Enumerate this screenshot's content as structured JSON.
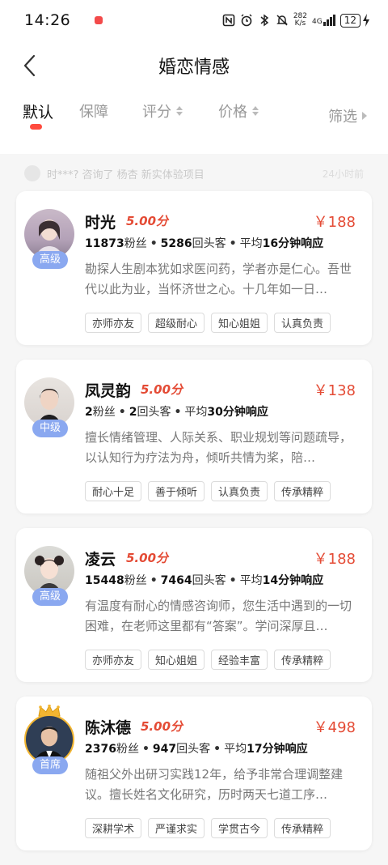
{
  "status_bar": {
    "time": "14:26",
    "net_speed_value": "282",
    "net_speed_unit": "K/s",
    "signal_label": "4G",
    "battery": "12"
  },
  "nav": {
    "title": "婚恋情感"
  },
  "tabs": [
    {
      "label": "默认"
    },
    {
      "label": "保障"
    },
    {
      "label": "评分"
    },
    {
      "label": "价格"
    },
    {
      "label": "筛选"
    }
  ],
  "ticker": {
    "text": "时***? 咨询了 杨杏 新实体验项目",
    "time": "24小时前"
  },
  "counselors": [
    {
      "name": "时光",
      "rating": "5.00分",
      "price": "￥188",
      "level": "高级",
      "fans": "11873",
      "fans_label": "粉丝",
      "repeat": "5286",
      "repeat_label": "回头客",
      "avg_prefix": "平均",
      "response": "16分钟响应",
      "desc": "勘探人生剧本犹如求医问药，学者亦是仁心。吾世代以此为业，当怀济世之心。十几年如一日…",
      "tags": [
        "亦师亦友",
        "超级耐心",
        "知心姐姐",
        "认真负责"
      ]
    },
    {
      "name": "凤灵韵",
      "rating": "5.00分",
      "price": "￥138",
      "level": "中级",
      "fans": "2",
      "fans_label": "粉丝",
      "repeat": "2",
      "repeat_label": "回头客",
      "avg_prefix": "平均",
      "response": "30分钟响应",
      "desc": "擅长情绪管理、人际关系、职业规划等问题疏导，以认知行为疗法为舟，倾听共情为桨，陪…",
      "tags": [
        "耐心十足",
        "善于倾听",
        "认真负责",
        "传承精粹"
      ]
    },
    {
      "name": "凌云",
      "rating": "5.00分",
      "price": "￥188",
      "level": "高级",
      "fans": "15448",
      "fans_label": "粉丝",
      "repeat": "7464",
      "repeat_label": "回头客",
      "avg_prefix": "平均",
      "response": "14分钟响应",
      "desc": "有温度有耐心的情感咨询师，您生活中遇到的一切困难，在老师这里都有“答案”。学问深厚且…",
      "tags": [
        "亦师亦友",
        "知心姐姐",
        "经验丰富",
        "传承精粹"
      ]
    },
    {
      "name": "陈沐德",
      "rating": "5.00分",
      "price": "￥498",
      "level": "首席",
      "fans": "2376",
      "fans_label": "粉丝",
      "repeat": "947",
      "repeat_label": "回头客",
      "avg_prefix": "平均",
      "response": "17分钟响应",
      "desc": "随祖父外出研习实践12年，给予非常合理调整建议。擅长姓名文化研究，历时两天七道工序…",
      "tags": [
        "深耕学术",
        "严谨求实",
        "学贯古今",
        "传承精粹"
      ]
    }
  ],
  "colors": {
    "accent": "#e44b35",
    "tab_indicator": "#ff4b3e",
    "level_badge": "#8aa8f0"
  }
}
